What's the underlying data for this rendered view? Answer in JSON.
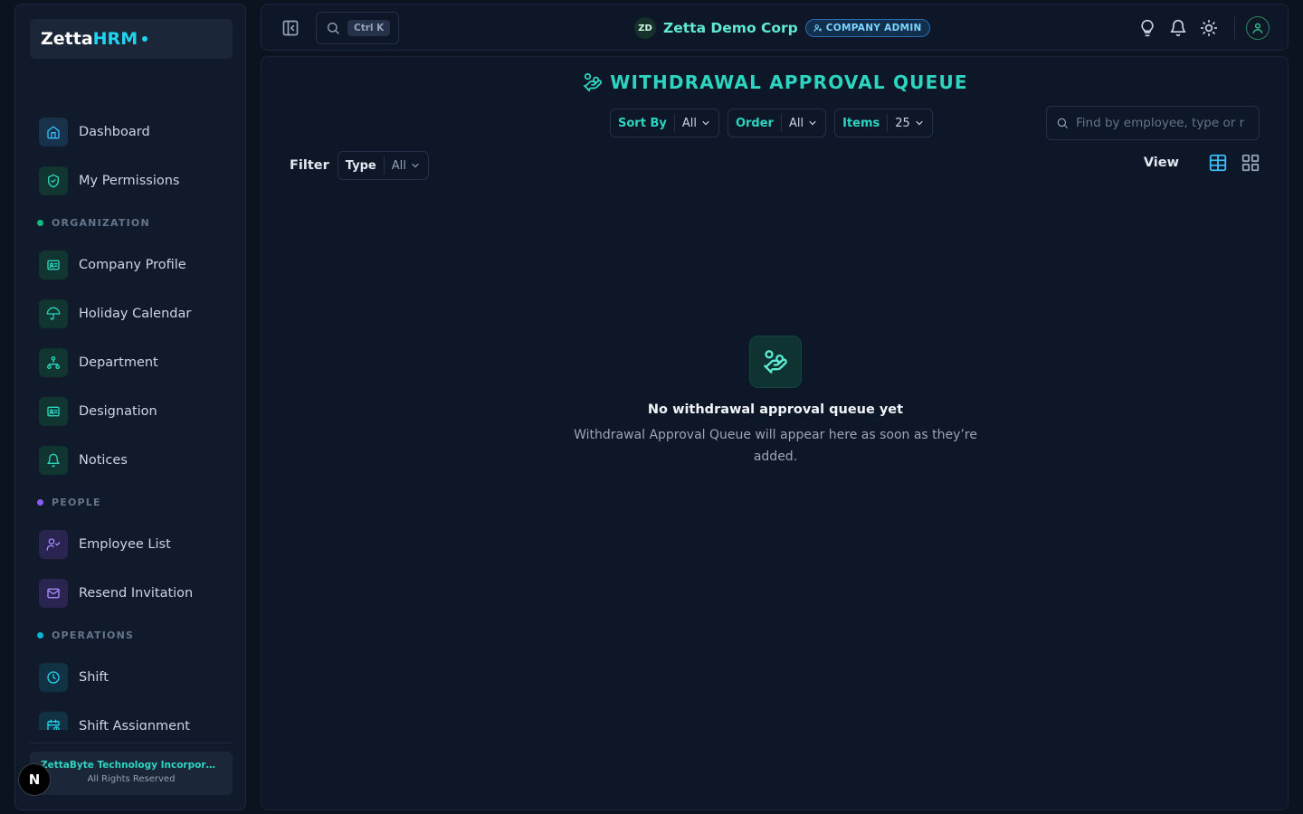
{
  "brand": {
    "prefix": "Zetta",
    "suffix": "HRM"
  },
  "sidebar": {
    "items": [
      {
        "label": "Dashboard",
        "icon": "home-icon"
      },
      {
        "label": "My Permissions",
        "icon": "shield-check-icon"
      }
    ],
    "sections": [
      {
        "label": "ORGANIZATION",
        "color": "#10b981",
        "items": [
          {
            "label": "Company Profile",
            "icon": "id-card-icon"
          },
          {
            "label": "Holiday Calendar",
            "icon": "umbrella-icon"
          },
          {
            "label": "Department",
            "icon": "org-chart-icon"
          },
          {
            "label": "Designation",
            "icon": "id-card-icon"
          },
          {
            "label": "Notices",
            "icon": "bell-icon"
          }
        ]
      },
      {
        "label": "PEOPLE",
        "color": "#8b5cf6",
        "items": [
          {
            "label": "Employee List",
            "icon": "user-check-icon"
          },
          {
            "label": "Resend Invitation",
            "icon": "mail-icon"
          }
        ]
      },
      {
        "label": "OPERATIONS",
        "color": "#06b6d4",
        "items": [
          {
            "label": "Shift",
            "icon": "clock-icon"
          },
          {
            "label": "Shift Assignment",
            "icon": "calendar-clock-icon"
          }
        ]
      }
    ],
    "footer": {
      "company": "ZettaByte Technology Incorporated",
      "rights": "All Rights Reserved"
    },
    "badge": "N"
  },
  "topbar": {
    "search_shortcut": "Ctrl K",
    "org_initials": "ZD",
    "org_name": "Zetta Demo Corp",
    "role": "COMPANY ADMIN"
  },
  "main": {
    "title": "WITHDRAWAL APPROVAL QUEUE",
    "controls": [
      {
        "label": "Sort By",
        "value": "All"
      },
      {
        "label": "Order",
        "value": "All"
      },
      {
        "label": "Items",
        "value": "25"
      }
    ],
    "search_placeholder": "Find by employee, type or r",
    "filter": {
      "label": "Filter",
      "type_label": "Type",
      "type_value": "All"
    },
    "view_label": "View",
    "empty": {
      "title": "No withdrawal approval queue yet",
      "description": "Withdrawal Approval Queue will appear here as soon as they’re added."
    }
  },
  "colors": {
    "accent": "#2dd4bf",
    "background": "#0b1220",
    "panel": "#0e1728"
  }
}
